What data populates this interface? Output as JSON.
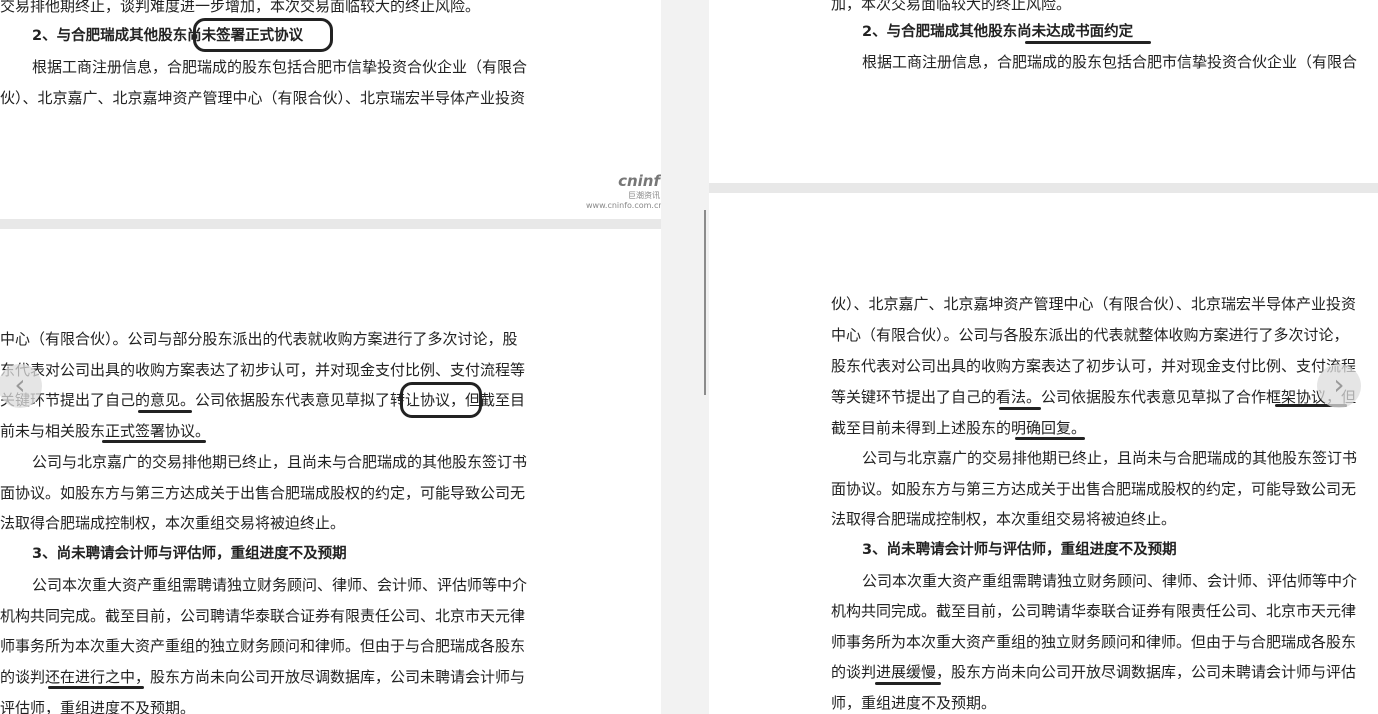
{
  "left": {
    "top_page": [
      "交易排他期终止，谈判难度进一步增加，本次交易面临较大的终止风险。",
      "2、与合肥瑞成其他股东尚未签署正式协议",
      "根据工商注册信息，合肥瑞成的股东包括合肥市信挚投资合伙企业（有限合",
      "伙）、北京嘉广、北京嘉坤资产管理中心（有限合伙）、北京瑞宏半导体产业投资"
    ],
    "watermark_logo": "cninf",
    "watermark_sub": "巨潮资讯",
    "watermark_url": "www.cninfo.com.cn",
    "bottom_page": [
      "中心（有限合伙）。公司与部分股东派出的代表就收购方案进行了多次讨论，股",
      "东代表对公司出具的收购方案表达了初步认可，并对现金支付比例、支付流程等",
      "关键环节提出了自己的意见。公司依据股东代表意见草拟了转让协议，但截至目",
      "前未与相关股东正式签署协议。",
      "公司与北京嘉广的交易排他期已终止，且尚未与合肥瑞成的其他股东签订书",
      "面协议。如股东方与第三方达成关于出售合肥瑞成股权的约定，可能导致公司无",
      "法取得合肥瑞成控制权，本次重组交易将被迫终止。",
      "3、尚未聘请会计师与评估师，重组进度不及预期",
      "公司本次重大资产重组需聘请独立财务顾问、律师、会计师、评估师等中介",
      "机构共同完成。截至目前，公司聘请华泰联合证券有限责任公司、北京市天元律",
      "师事务所为本次重大资产重组的独立财务顾问和律师。但由于与合肥瑞成各股东",
      "的谈判还在进行之中，股东方尚未向公司开放尽调数据库，公司未聘请会计师与",
      "评估师，重组进度不及预期。"
    ]
  },
  "right": {
    "top_page": [
      "加，本次交易面临较大的终止风险。",
      "2、与合肥瑞成其他股东尚未达成书面约定",
      "根据工商注册信息，合肥瑞成的股东包括合肥市信挚投资合伙企业（有限合"
    ],
    "bottom_page": [
      "伙）、北京嘉广、北京嘉坤资产管理中心（有限合伙）、北京瑞宏半导体产业投资",
      "中心（有限合伙）。公司与各股东派出的代表就整体收购方案进行了多次讨论，",
      "股东代表对公司出具的收购方案表达了初步认可，并对现金支付比例、支付流程",
      "等关键环节提出了自己的看法。公司依据股东代表意见草拟了合作框架协议，但",
      "截至目前未得到上述股东的明确回复。",
      "公司与北京嘉广的交易排他期已终止，且尚未与合肥瑞成的其他股东签订书",
      "面协议。如股东方与第三方达成关于出售合肥瑞成股权的约定，可能导致公司无",
      "法取得合肥瑞成控制权，本次重组交易将被迫终止。",
      "3、尚未聘请会计师与评估师，重组进度不及预期",
      "公司本次重大资产重组需聘请独立财务顾问、律师、会计师、评估师等中介",
      "机构共同完成。截至目前，公司聘请华泰联合证券有限责任公司、北京市天元律",
      "师事务所为本次重大资产重组的独立财务顾问和律师。但由于与合肥瑞成各股东",
      "的谈判进展缓慢，股东方尚未向公司开放尽调数据库，公司未聘请会计师与评估",
      "师，重组进度不及预期。"
    ]
  },
  "nav": {
    "prev": "‹",
    "next": "›"
  },
  "colors": {
    "red_mark": "#d1202a",
    "blue_mark": "#1f3fbf",
    "page_gap": "#e8e8e8"
  }
}
